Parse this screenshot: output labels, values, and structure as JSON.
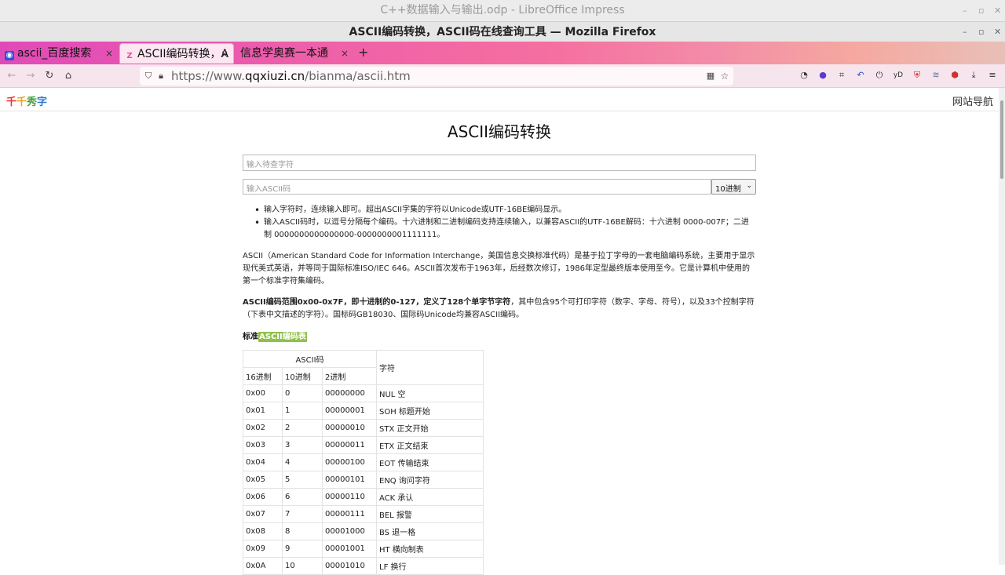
{
  "lo_window": {
    "title": "C++数据输入与输出.odp - LibreOffice Impress"
  },
  "ff_window": {
    "title": "ASCII编码转换，ASCII码在线查询工具 — Mozilla Firefox"
  },
  "window_controls": {
    "minimize": "–",
    "maximize": "▫",
    "close": "✕"
  },
  "tabs": [
    {
      "label": "ascii_百度搜索",
      "favicon": "baidu-icon"
    },
    {
      "label": "ASCII编码转换，A",
      "favicon": "qqxiuzi-icon"
    },
    {
      "label": "信息学奥赛一本通",
      "favicon": ""
    }
  ],
  "newtab_label": "+",
  "tab_close": "×",
  "url": {
    "prefix": "https://www.",
    "host": "qqxiuzi.cn",
    "path": "/bianma/ascii.htm"
  },
  "site": {
    "logo": [
      "千",
      "千",
      "秀",
      "字"
    ],
    "nav": "网站导航"
  },
  "page": {
    "title": "ASCII编码转换",
    "input_char_placeholder": "输入待查字符",
    "input_code_placeholder": "输入ASCII码",
    "base_select": "10进制",
    "tips": [
      "输入字符时，连续输入即可。超出ASCII字集的字符以Unicode或UTF-16BE编码显示。",
      "输入ASCII码时，以逗号分隔每个编码。十六进制和二进制编码支持连续输入，以兼容ASCII的UTF-16BE解码：十六进制 0000-007F；二进制 0000000000000000-0000000001111111。"
    ],
    "intro": "ASCII（American Standard Code for Information Interchange，美国信息交换标准代码）是基于拉丁字母的一套电脑编码系统，主要用于显示现代美式英语，并等同于国际标准ISO/IEC 646。ASCII首次发布于1963年，后经数次修订，1986年定型最终版本使用至今。它是计算机中使用的第一个标准字符集编码。",
    "range_bold": "ASCII编码范围0x00-0x7F，即十进制的0-127，定义了128个单字节字符",
    "range_rest": "，其中包含95个可打印字符（数字、字母、符号），以及33个控制字符（下表中文描述的字符）。国标码GB18030、国际码Unicode均兼容ASCII编码。",
    "table_heading_prefix": "标准",
    "table_heading_hl": "ASCII编码表"
  },
  "table": {
    "group_header": "ASCII码",
    "char_header": "字符",
    "col_headers": [
      "16进制",
      "10进制",
      "2进制"
    ],
    "rows": [
      [
        "0x00",
        "0",
        "00000000",
        "NUL 空"
      ],
      [
        "0x01",
        "1",
        "00000001",
        "SOH 标题开始"
      ],
      [
        "0x02",
        "2",
        "00000010",
        "STX  正文开始"
      ],
      [
        "0x03",
        "3",
        "00000011",
        "ETX  正文结束"
      ],
      [
        "0x04",
        "4",
        "00000100",
        "EOT  传输结束"
      ],
      [
        "0x05",
        "5",
        "00000101",
        "ENQ  询问字符"
      ],
      [
        "0x06",
        "6",
        "00000110",
        "ACK  承认"
      ],
      [
        "0x07",
        "7",
        "00000111",
        "BEL  报警"
      ],
      [
        "0x08",
        "8",
        "00001000",
        "BS   退一格"
      ],
      [
        "0x09",
        "9",
        "00001001",
        "HT   横向制表"
      ],
      [
        "0x0A",
        "10",
        "00001010",
        "LF   换行"
      ]
    ]
  }
}
